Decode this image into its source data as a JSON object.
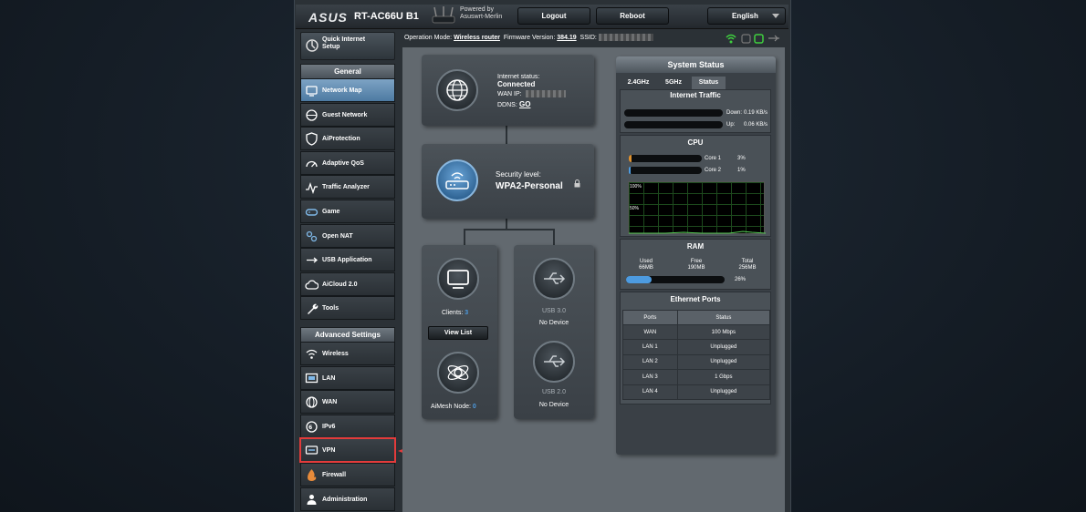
{
  "header": {
    "brand": "ASUS",
    "model": "RT-AC66U B1",
    "powered_by_line1": "Powered by",
    "powered_by_line2": "Asuswrt-Merlin",
    "logout_label": "Logout",
    "reboot_label": "Reboot",
    "language": "English"
  },
  "opbar": {
    "operation_mode_label": "Operation Mode:",
    "operation_mode_value": "Wireless router",
    "firmware_label": "Firmware Version:",
    "firmware_value": "384.19",
    "ssid_label": "SSID:"
  },
  "sidebar": {
    "quick_setup_line1": "Quick Internet",
    "quick_setup_line2": "Setup",
    "general_title": "General",
    "general_items": [
      {
        "label": "Network Map",
        "icon": "network-map-icon"
      },
      {
        "label": "Guest Network",
        "icon": "guest-network-icon"
      },
      {
        "label": "AiProtection",
        "icon": "shield-icon"
      },
      {
        "label": "Adaptive QoS",
        "icon": "gauge-icon"
      },
      {
        "label": "Traffic Analyzer",
        "icon": "traffic-icon"
      },
      {
        "label": "Game",
        "icon": "gamepad-icon"
      },
      {
        "label": "Open NAT",
        "icon": "open-nat-icon"
      },
      {
        "label": "USB Application",
        "icon": "usb-app-icon"
      },
      {
        "label": "AiCloud 2.0",
        "icon": "cloud-icon"
      },
      {
        "label": "Tools",
        "icon": "wrench-icon"
      }
    ],
    "advanced_title": "Advanced Settings",
    "advanced_items": [
      {
        "label": "Wireless",
        "icon": "wifi-icon"
      },
      {
        "label": "LAN",
        "icon": "lan-icon"
      },
      {
        "label": "WAN",
        "icon": "globe-icon"
      },
      {
        "label": "IPv6",
        "icon": "ipv6-icon"
      },
      {
        "label": "VPN",
        "icon": "vpn-icon"
      },
      {
        "label": "Firewall",
        "icon": "firewall-icon"
      },
      {
        "label": "Administration",
        "icon": "admin-icon"
      }
    ]
  },
  "internet": {
    "status_label": "Internet status:",
    "status_value": "Connected",
    "wan_ip_label": "WAN IP:",
    "ddns_label": "DDNS:",
    "ddns_link": "GO"
  },
  "security": {
    "label": "Security level:",
    "value": "WPA2-Personal"
  },
  "clients": {
    "label": "Clients:",
    "count": "3",
    "view_list": "View List"
  },
  "aimesh": {
    "label": "AiMesh Node:",
    "count": "0"
  },
  "usb": [
    {
      "title": "USB 3.0",
      "status": "No Device"
    },
    {
      "title": "USB 2.0",
      "status": "No Device"
    }
  ],
  "system_status": {
    "title": "System Status",
    "tabs": [
      "2.4GHz",
      "5GHz",
      "Status"
    ],
    "internet_traffic": {
      "title": "Internet Traffic",
      "down_label": "Down:",
      "down_value": "0.19 KB/s",
      "up_label": "Up:",
      "up_value": "0.06 KB/s"
    },
    "cpu": {
      "title": "CPU",
      "cores": [
        {
          "label": "Core 1",
          "value": "3%",
          "fraction": 0.03
        },
        {
          "label": "Core 2",
          "value": "1%",
          "fraction": 0.01
        }
      ],
      "graph_top_label": "100%",
      "graph_mid_label": "50%"
    },
    "ram": {
      "title": "RAM",
      "used_label": "Used",
      "used_value": "66MB",
      "free_label": "Free",
      "free_value": "190MB",
      "total_label": "Total",
      "total_value": "256MB",
      "percent": "26%",
      "fraction": 0.26
    },
    "ethernet": {
      "title": "Ethernet Ports",
      "headers": [
        "Ports",
        "Status"
      ],
      "rows": [
        [
          "WAN",
          "100 Mbps"
        ],
        [
          "LAN 1",
          "Unplugged"
        ],
        [
          "LAN 2",
          "Unplugged"
        ],
        [
          "LAN 3",
          "1 Gbps"
        ],
        [
          "LAN 4",
          "Unplugged"
        ]
      ]
    }
  },
  "colors": {
    "active_menu": "#5b88b0",
    "highlight": "#e23b3b",
    "accent_blue": "#4d9be0"
  }
}
